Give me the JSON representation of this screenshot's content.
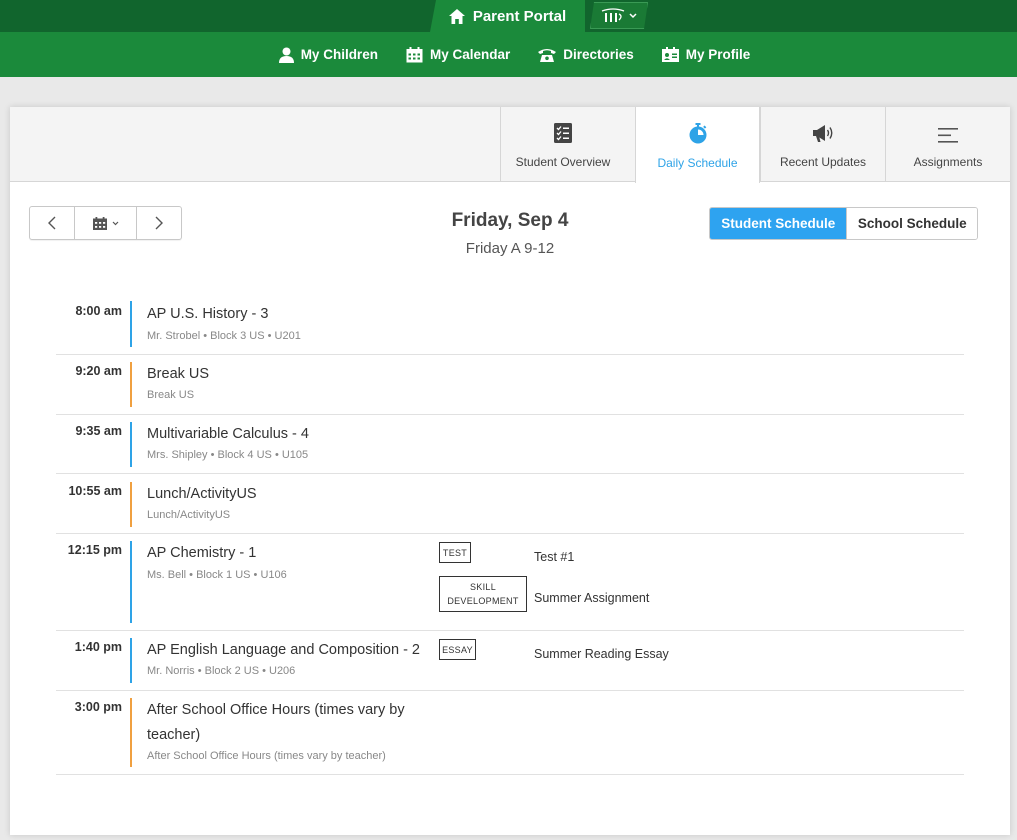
{
  "header": {
    "portal_title": "Parent Portal",
    "nav": [
      {
        "label": "My Children",
        "icon": "person-icon"
      },
      {
        "label": "My Calendar",
        "icon": "calendar-icon"
      },
      {
        "label": "Directories",
        "icon": "phone-icon"
      },
      {
        "label": "My Profile",
        "icon": "id-card-icon"
      }
    ]
  },
  "tabs": [
    {
      "label": "Student Overview",
      "icon": "checklist-icon",
      "active": false
    },
    {
      "label": "Daily Schedule",
      "icon": "stopwatch-icon",
      "active": true
    },
    {
      "label": "Recent Updates",
      "icon": "megaphone-icon",
      "active": false
    },
    {
      "label": "Assignments",
      "icon": "lines-icon",
      "active": false
    }
  ],
  "date": {
    "title": "Friday, Sep 4",
    "subtitle": "Friday A 9-12"
  },
  "toggle": {
    "student": "Student Schedule",
    "school": "School Schedule"
  },
  "schedule": [
    {
      "time": "8:00 am",
      "title": "AP U.S. History - 3",
      "sub": "Mr. Strobel • Block 3 US • U201",
      "color": "#2ea3e7"
    },
    {
      "time": "9:20 am",
      "title": "Break US",
      "sub": "Break US",
      "color": "#f0a040"
    },
    {
      "time": "9:35 am",
      "title": "Multivariable Calculus - 4",
      "sub": "Mrs. Shipley • Block 4 US • U105",
      "color": "#2ea3e7"
    },
    {
      "time": "10:55 am",
      "title": "Lunch/ActivityUS",
      "sub": "Lunch/ActivityUS",
      "color": "#f0a040"
    },
    {
      "time": "12:15 pm",
      "title": "AP Chemistry - 1",
      "sub": "Ms. Bell • Block 1 US • U106",
      "color": "#2ea3e7",
      "assignments": [
        {
          "tag": "TEST",
          "text": "Test #1"
        },
        {
          "tag1": "SKILL",
          "tag2": "DEVELOPMENT",
          "text": "Summer Assignment"
        }
      ]
    },
    {
      "time": "1:40 pm",
      "title": "AP English Language and Composition - 2",
      "sub": "Mr. Norris • Block 2 US • U206",
      "color": "#2ea3e7",
      "assignments": [
        {
          "tag": "ESSAY",
          "text": "Summer Reading Essay"
        }
      ]
    },
    {
      "time": "3:00 pm",
      "title1": "After School Office Hours (times vary by",
      "title2": "teacher)",
      "sub": "After School Office Hours (times vary by teacher)",
      "color": "#f0a040"
    }
  ]
}
